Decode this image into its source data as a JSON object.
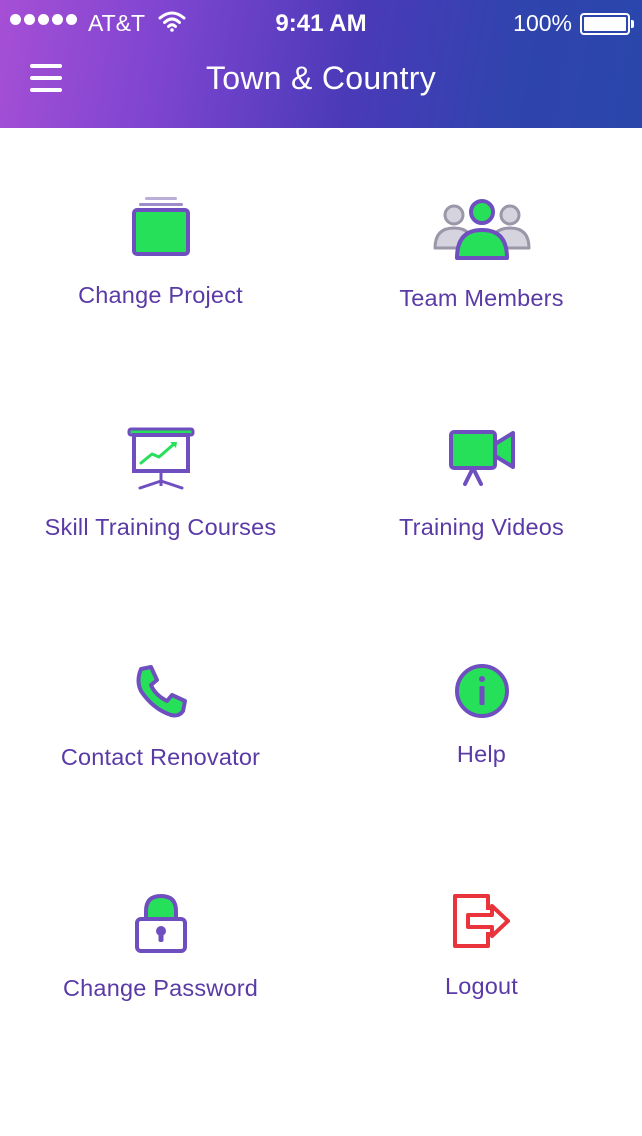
{
  "status_bar": {
    "carrier": "AT&T",
    "time": "9:41 AM",
    "battery": "100%"
  },
  "header": {
    "title": "Town & Country",
    "menu_icon": "hamburger-menu-icon"
  },
  "colors": {
    "accent_green": "#26e05a",
    "icon_purple": "#6f4fc0",
    "label_purple": "#5a3aa6",
    "logout_red": "#e8343a",
    "gradient_start": "#a64fd6",
    "gradient_end": "#2a46ab"
  },
  "menu": [
    {
      "label": "Change Project",
      "icon": "project-icon"
    },
    {
      "label": "Team Members",
      "icon": "team-icon"
    },
    {
      "label": "Skill Training Courses",
      "icon": "presentation-icon"
    },
    {
      "label": "Training Videos",
      "icon": "video-camera-icon"
    },
    {
      "label": "Contact Renovator",
      "icon": "phone-icon"
    },
    {
      "label": "Help",
      "icon": "info-icon"
    },
    {
      "label": "Change Password",
      "icon": "lock-icon"
    },
    {
      "label": "Logout",
      "icon": "logout-icon"
    }
  ]
}
